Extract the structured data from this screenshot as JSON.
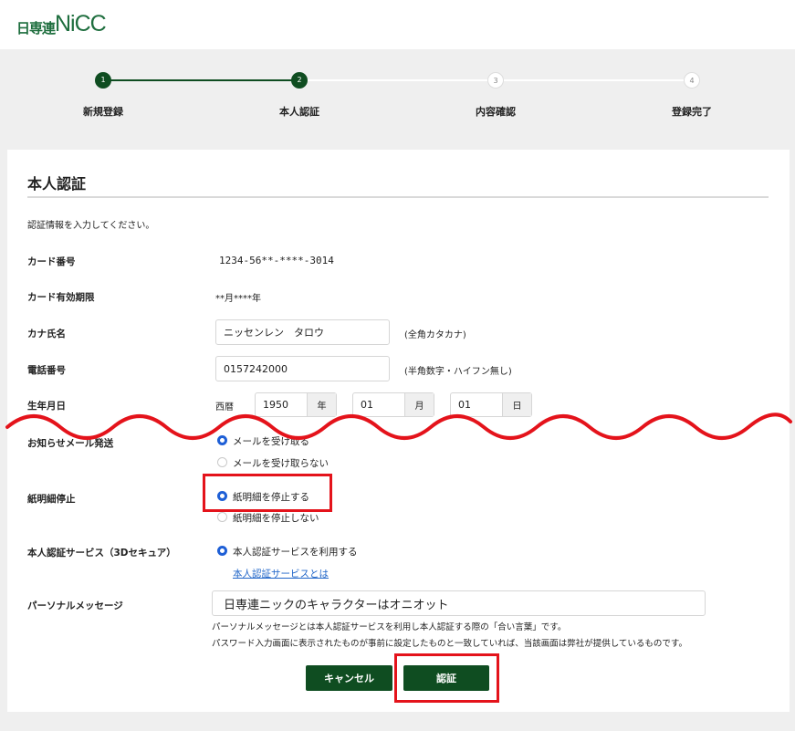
{
  "logo": {
    "jp": "日専連",
    "en": "NiCC"
  },
  "steps": [
    {
      "number": "1",
      "label": "新規登録"
    },
    {
      "number": "2",
      "label": "本人認証"
    },
    {
      "number": "3",
      "label": "内容確認"
    },
    {
      "number": "4",
      "label": "登録完了"
    }
  ],
  "page": {
    "title": "本人認証",
    "instruction": "認証情報を入力してください。"
  },
  "form": {
    "card_number": {
      "label": "カード番号",
      "value": "1234-56**-****-3014"
    },
    "expiry": {
      "label": "カード有効期限",
      "value": "**月****年"
    },
    "kana_name": {
      "label": "カナ氏名",
      "value": "ニッセンレン　タロウ",
      "hint": "(全角カタカナ)"
    },
    "phone": {
      "label": "電話番号",
      "value": "0157242000",
      "hint": "(半角数字・ハイフン無し)"
    },
    "birthdate": {
      "label": "生年月日",
      "era": "西暦",
      "year": "1950",
      "year_unit": "年",
      "month": "01",
      "month_unit": "月",
      "day": "01",
      "day_unit": "日"
    },
    "mail": {
      "label": "お知らせメール発送",
      "option_on": "メールを受け取る",
      "option_off": "メールを受け取らない",
      "selected": "option_on"
    },
    "statement": {
      "label": "紙明細停止",
      "option_on": "紙明細を停止する",
      "option_off": "紙明細を停止しない",
      "selected": "option_on"
    },
    "secure": {
      "label": "本人認証サービス（3Dセキュア）",
      "option_on": "本人認証サービスを利用する",
      "link": "本人認証サービスとは"
    },
    "personal_message": {
      "label": "パーソナルメッセージ",
      "value": "日専連ニックのキャラクターはオニオット",
      "note1": "パーソナルメッセージとは本人認証サービスを利用し本人認証する際の「合い言葉」です。",
      "note2": "パスワード入力画面に表示されたものが事前に設定したものと一致していれば、当該画面は弊社が提供しているものです。"
    }
  },
  "buttons": {
    "cancel": "キャンセル",
    "submit": "認証"
  },
  "colors": {
    "brand_green": "#0f4d21",
    "radio_blue": "#1e5fd6",
    "annotation_red": "#e4131b",
    "link_blue": "#1e64c8"
  }
}
